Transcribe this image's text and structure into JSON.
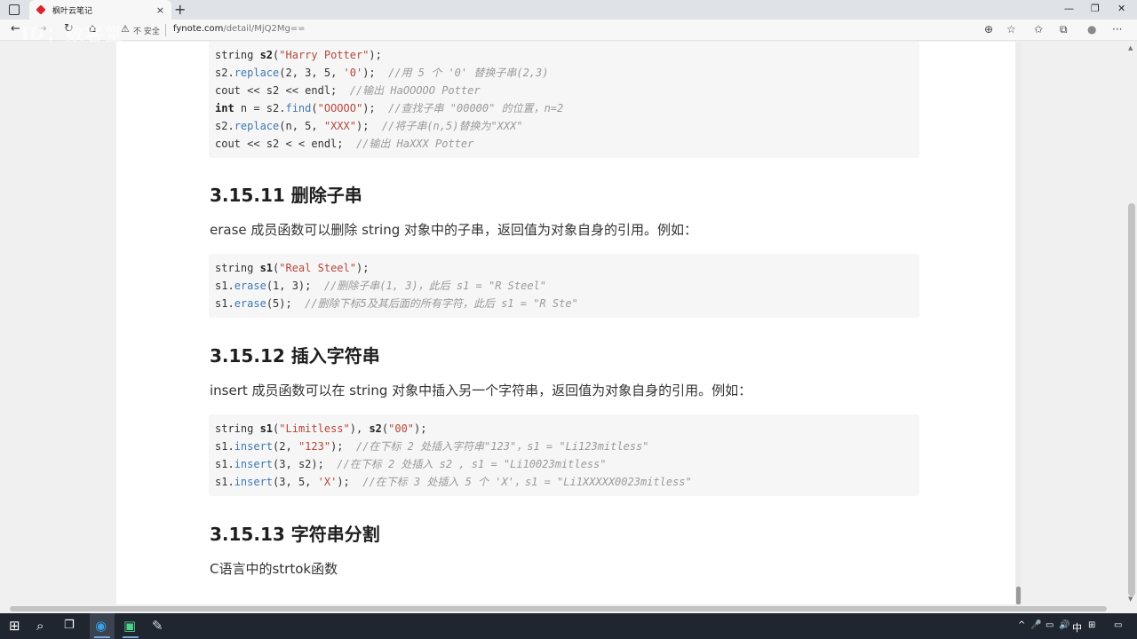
{
  "browser": {
    "tab_title": "枫叶云笔记",
    "tab_close": "×",
    "new_tab": "+",
    "minimize": "—",
    "restore": "❐",
    "close": "✕",
    "back": "←",
    "forward": "→",
    "reload": "↻",
    "home": "⌂",
    "warning_glyph": "⚠",
    "insecure_label": "不 安全",
    "url_host": "fyn",
    "url_host2": "ote.com",
    "url_path": "/detail/MjQ2Mg==",
    "zoom_glyph": "⊕",
    "star_glyph": "☆",
    "favorites_glyph": "✩",
    "collections_glyph": "⧉",
    "profile_glyph": "●",
    "menu_glyph": "···"
  },
  "article": {
    "code_replace": [
      {
        "parts": [
          {
            "t": "string "
          },
          {
            "t": "s2",
            "c": "b"
          },
          {
            "t": "("
          },
          {
            "t": "\"Harry Potter\"",
            "c": "str"
          },
          {
            "t": ");"
          }
        ]
      },
      {
        "parts": [
          {
            "t": "s2."
          },
          {
            "t": "replace",
            "c": "fn"
          },
          {
            "t": "(2, 3, 5, "
          },
          {
            "t": "'0'",
            "c": "str"
          },
          {
            "t": ");  "
          },
          {
            "t": "//用 5 个 '0' 替换子串(2,3)",
            "c": "cm"
          }
        ]
      },
      {
        "parts": [
          {
            "t": "cout << s2 << endl;  "
          },
          {
            "t": "//输出 HaOOOOO Potter",
            "c": "cm"
          }
        ]
      },
      {
        "parts": [
          {
            "t": "int",
            "c": "b"
          },
          {
            "t": " n = s2."
          },
          {
            "t": "find",
            "c": "fn"
          },
          {
            "t": "("
          },
          {
            "t": "\"OOOOO\"",
            "c": "str"
          },
          {
            "t": ");  "
          },
          {
            "t": "//查找子串 \"00000\" 的位置，n=2",
            "c": "cm"
          }
        ]
      },
      {
        "parts": [
          {
            "t": "s2."
          },
          {
            "t": "replace",
            "c": "fn"
          },
          {
            "t": "(n, 5, "
          },
          {
            "t": "\"XXX\"",
            "c": "str"
          },
          {
            "t": ");  "
          },
          {
            "t": "//将子串(n,5)替换为\"XXX\"",
            "c": "cm"
          }
        ]
      },
      {
        "parts": [
          {
            "t": "cout << s2 < < endl;  "
          },
          {
            "t": "//输出 HaXXX Potter",
            "c": "cm"
          }
        ]
      }
    ],
    "h_erase": "3.15.11 删除子串",
    "p_erase": "erase 成员函数可以删除 string 对象中的子串，返回值为对象自身的引用。例如：",
    "code_erase": [
      {
        "parts": [
          {
            "t": "string "
          },
          {
            "t": "s1",
            "c": "b"
          },
          {
            "t": "("
          },
          {
            "t": "\"Real Steel\"",
            "c": "str"
          },
          {
            "t": ");"
          }
        ]
      },
      {
        "parts": [
          {
            "t": "s1."
          },
          {
            "t": "erase",
            "c": "fn"
          },
          {
            "t": "(1, 3);  "
          },
          {
            "t": "//删除子串(1, 3)，此后 s1 = \"R Steel\"",
            "c": "cm"
          }
        ]
      },
      {
        "parts": [
          {
            "t": "s1."
          },
          {
            "t": "erase",
            "c": "fn"
          },
          {
            "t": "(5);  "
          },
          {
            "t": "//删除下标5及其后面的所有字符，此后 s1 = \"R Ste\"",
            "c": "cm"
          }
        ]
      }
    ],
    "h_insert": "3.15.12 插入字符串",
    "p_insert": "insert 成员函数可以在 string 对象中插入另一个字符串，返回值为对象自身的引用。例如：",
    "code_insert": [
      {
        "parts": [
          {
            "t": "string "
          },
          {
            "t": "s1",
            "c": "b"
          },
          {
            "t": "("
          },
          {
            "t": "\"Limitless\"",
            "c": "str"
          },
          {
            "t": "), "
          },
          {
            "t": "s2",
            "c": "b"
          },
          {
            "t": "("
          },
          {
            "t": "\"00\"",
            "c": "str"
          },
          {
            "t": ");"
          }
        ]
      },
      {
        "parts": [
          {
            "t": "s1."
          },
          {
            "t": "insert",
            "c": "fn"
          },
          {
            "t": "(2, "
          },
          {
            "t": "\"123\"",
            "c": "str"
          },
          {
            "t": ");  "
          },
          {
            "t": "//在下标 2 处插入字符串\"123\"，s1 = \"Li123mitless\"",
            "c": "cm"
          }
        ]
      },
      {
        "parts": [
          {
            "t": "s1."
          },
          {
            "t": "insert",
            "c": "fn"
          },
          {
            "t": "(3, s2);  "
          },
          {
            "t": "//在下标 2 处插入 s2 , s1 = \"Li10023mitless\"",
            "c": "cm"
          }
        ]
      },
      {
        "parts": [
          {
            "t": "s1."
          },
          {
            "t": "insert",
            "c": "fn"
          },
          {
            "t": "(3, 5, "
          },
          {
            "t": "'X'",
            "c": "str"
          },
          {
            "t": ");  "
          },
          {
            "t": "//在下标 3 处插入 5 个 'X'，s1 = \"Li1XXXXX0023mitless\"",
            "c": "cm"
          }
        ]
      }
    ],
    "h_split": "3.15.13 字符串分割",
    "p_split": "C语言中的strtok函数"
  },
  "watermark": "ID：数客堂",
  "taskbar": {
    "start_glyph": "⊞",
    "search_glyph": "⌕",
    "taskview_glyph": "❐",
    "edge_glyph": "◉",
    "ide_glyph": "▣",
    "app_glyph": "✎",
    "tray_up": "^",
    "tray_mic": "🎤",
    "tray_net": "▭",
    "tray_vol": "🔊",
    "ime": "中",
    "tray_grid": "⊞",
    "notify": "▭"
  }
}
